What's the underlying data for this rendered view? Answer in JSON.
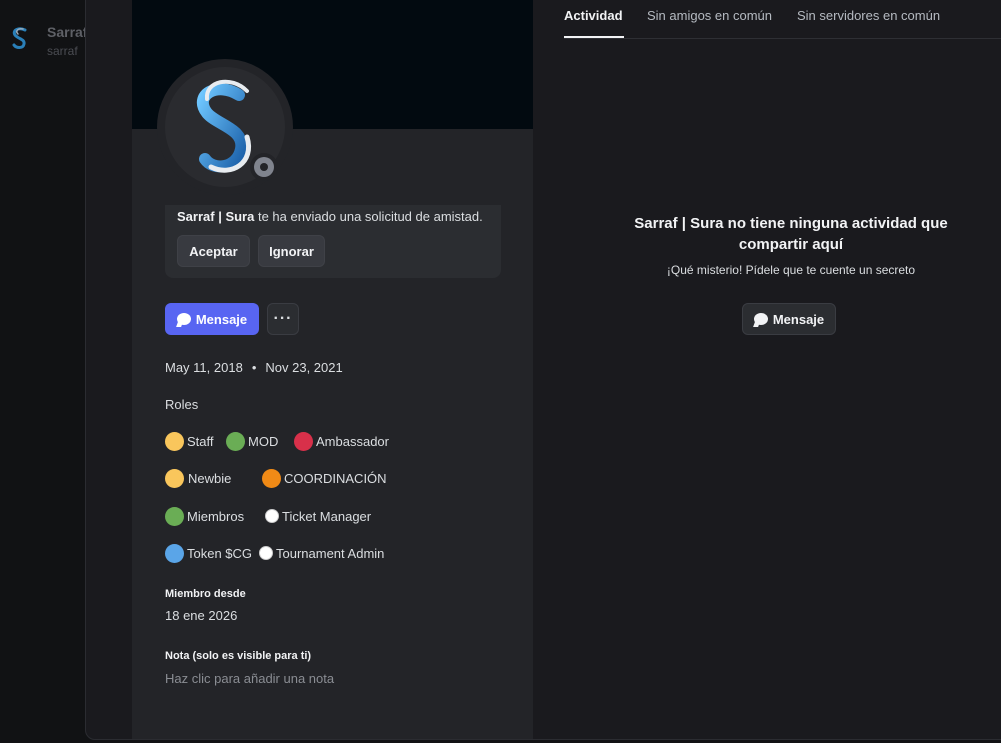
{
  "background": {
    "dm_name": "Sarraf",
    "dm_username": "sarraf"
  },
  "profile": {
    "request_user": "Sarraf | Sura",
    "request_text": " te ha enviado una solicitud de amistad.",
    "accept_label": "Aceptar",
    "ignore_label": "Ignorar",
    "message_label": "Mensaje",
    "more_label": "···",
    "date_1": "May 11, 2018",
    "date_sep": "•",
    "date_2": "Nov 23, 2021",
    "roles_title": "Roles",
    "roles": [
      {
        "name": "Staff",
        "color": "#f9c65c"
      },
      {
        "name": "MOD",
        "color": "#6aad55"
      },
      {
        "name": "Ambassador",
        "color": "#d8304a"
      },
      {
        "name": "Newbie",
        "color": "#f9c65c"
      },
      {
        "name": "COORDINACIÓN",
        "color": "#f08a16"
      },
      {
        "name": "Miembros",
        "color": "#6aad55"
      },
      {
        "name": "Ticket Manager",
        "color": "#ffffff"
      },
      {
        "name": "Token $CG",
        "color": "#5aa5e8"
      },
      {
        "name": "Tournament Admin",
        "color": "#ffffff"
      }
    ],
    "member_since_label": "Miembro desde",
    "member_since_value": "18 ene 2026",
    "note_label": "Nota (solo es visible para ti)",
    "note_placeholder": "Haz clic para añadir una nota",
    "status": "offline"
  },
  "tabs": {
    "activity": "Actividad",
    "friends": "Sin amigos en común",
    "servers": "Sin servidores en común"
  },
  "activity": {
    "title": "Sarraf | Sura no tiene ninguna actividad que compartir aquí",
    "subtitle": "¡Qué misterio! Pídele que te cuente un secreto",
    "message_label": "Mensaje"
  },
  "colors": {
    "accent": "#5865f2"
  }
}
